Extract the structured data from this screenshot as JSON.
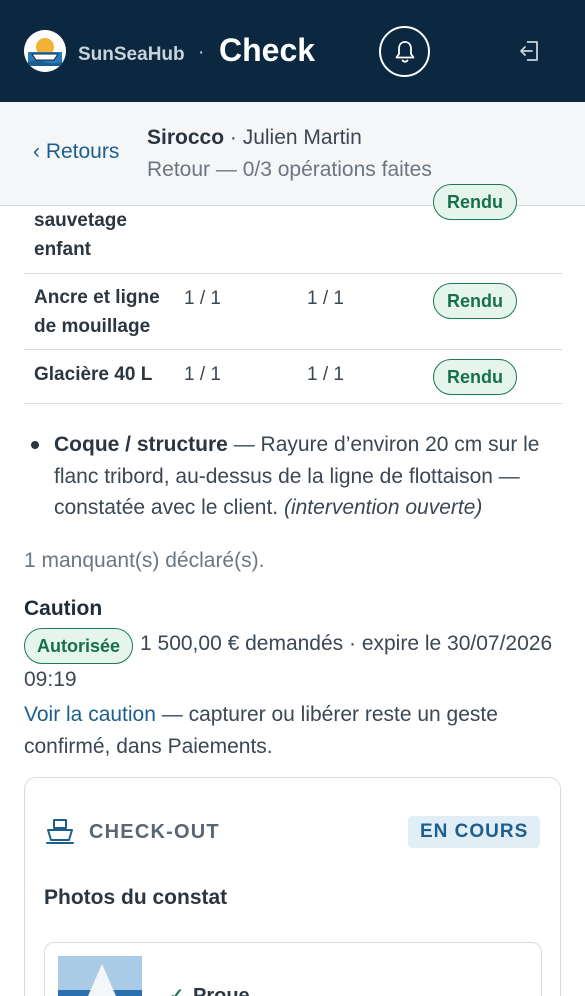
{
  "header": {
    "brand": "SunSeaHub",
    "separator": "·",
    "title": "Check",
    "icons": [
      "logo-icon",
      "bell-icon",
      "logout-icon"
    ]
  },
  "subheader": {
    "back_label": "‹ Retours",
    "boat": "Sirocco",
    "separator": " · ",
    "client": "Julien Martin",
    "status": "Retour — 0/3 opérations faites"
  },
  "table": {
    "rows": [
      {
        "name_lines": [
          "sauvetage",
          "enfant"
        ],
        "qty_out": "",
        "qty_in": "",
        "status": "Rendu"
      },
      {
        "name_lines": [
          "Ancre et ligne",
          "de mouillage"
        ],
        "qty_out": "1 / 1",
        "qty_in": "1 / 1",
        "status": "Rendu"
      },
      {
        "name_lines": [
          "Glacière 40 L"
        ],
        "qty_out": "1 / 1",
        "qty_in": "1 / 1",
        "status": "Rendu"
      }
    ]
  },
  "damage": {
    "category": "Coque / structure",
    "text": " — Rayure d’environ 20 cm sur le flanc tribord, au-dessus de la ligne de flottaison — constatée avec le client. ",
    "note": "(intervention ouverte)"
  },
  "missing_text": "1 manquant(s) déclaré(s).",
  "caution": {
    "title": "Caution",
    "badge": "Autorisée",
    "line1": "1 500,00 € demandés · expire le 30/07/2026",
    "line2": "09:19",
    "link": "Voir la caution",
    "note": " — capturer ou libérer reste un geste confirmé, dans Paiements."
  },
  "checkout_card": {
    "title": "CHECK-OUT",
    "status": "EN COURS",
    "photos_title": "Photos du constat",
    "photo_label": "Proue"
  },
  "colors": {
    "navy": "#0c2740",
    "accent_blue": "#1c5f8e",
    "green": "#1e7a55",
    "green_bg": "#e5f5ee"
  }
}
